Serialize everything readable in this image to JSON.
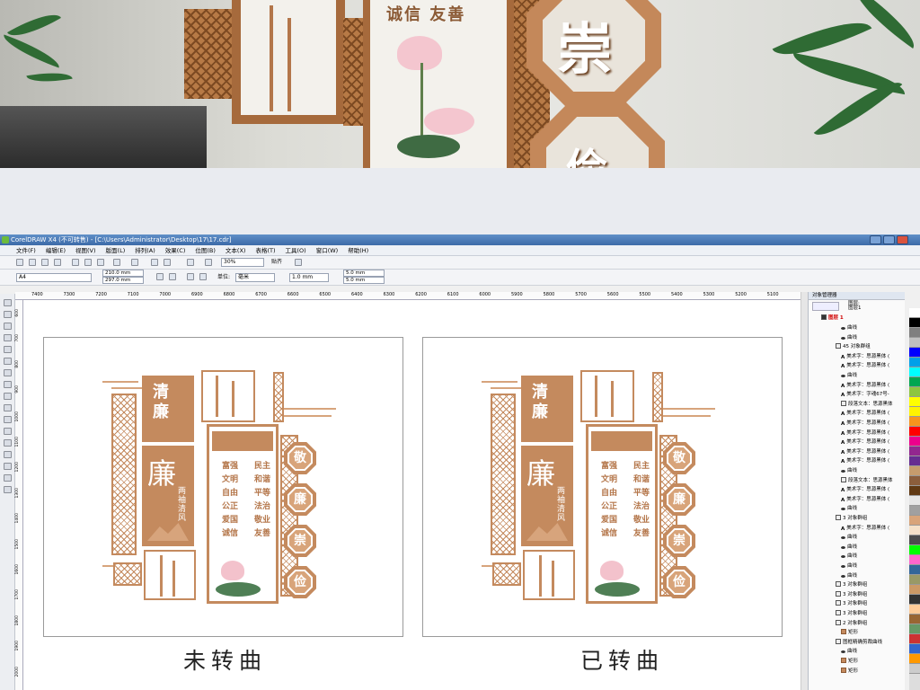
{
  "photo": {
    "panel_text_top": "诚信 友善",
    "octagon_char_1": "崇",
    "octagon_char_2": "俭"
  },
  "window": {
    "title": "CorelDRAW X4 (不可转售) - [C:\\Users\\Administrator\\Desktop\\17\\17.cdr]"
  },
  "menu": [
    "文件(F)",
    "编辑(E)",
    "视图(V)",
    "版面(L)",
    "排列(A)",
    "效果(C)",
    "位图(B)",
    "文本(X)",
    "表格(T)",
    "工具(O)",
    "窗口(W)",
    "帮助(H)"
  ],
  "toolbar": {
    "zoom": "30%",
    "snap": "贴齐",
    "page_size": "A4",
    "width": "210.0 mm",
    "height": "297.0 mm",
    "units_label": "单位:",
    "units": "毫米",
    "nudge": "1.0 mm",
    "dup_x": "5.0 mm",
    "dup_y": "5.0 mm"
  },
  "ruler_h": [
    "7400",
    "7300",
    "7200",
    "7100",
    "7000",
    "6900",
    "6800",
    "6700",
    "6600",
    "6500",
    "6400",
    "6300",
    "6200",
    "6100",
    "6000",
    "5900",
    "5800",
    "5700",
    "5600",
    "5500",
    "5400",
    "5300",
    "5200",
    "5100"
  ],
  "ruler_v": [
    "600",
    "700",
    "800",
    "900",
    "1000",
    "1100",
    "1200",
    "1300",
    "1400",
    "1500",
    "1600",
    "1700",
    "1800",
    "1900",
    "2000"
  ],
  "artwork": {
    "left_caption": "未转曲",
    "right_caption": "已转曲",
    "title_chars": [
      "清",
      "廉"
    ],
    "big_char": "廉",
    "side_text": "两袖清风",
    "values_rows": [
      [
        "富强",
        "民主"
      ],
      [
        "文明",
        "和谐"
      ],
      [
        "自由",
        "平等"
      ],
      [
        "公正",
        "法治"
      ],
      [
        "爱国",
        "敬业"
      ],
      [
        "诚信",
        "友善"
      ]
    ],
    "octagon_chars": [
      "敬",
      "廉",
      "崇",
      "俭"
    ]
  },
  "object_manager": {
    "title": "对象管理器",
    "page_label": "图层:",
    "page_sub": "图层1",
    "layer": "图层 1",
    "rows": [
      {
        "t": "curve",
        "label": "曲线",
        "indent": 1
      },
      {
        "t": "curve",
        "label": "曲线",
        "indent": 1
      },
      {
        "t": "group",
        "label": "45 对象群组",
        "indent": 0
      },
      {
        "t": "txt",
        "label": "美术字：思源黑体 (",
        "indent": 1
      },
      {
        "t": "txt",
        "label": "美术字：思源黑体 (",
        "indent": 1
      },
      {
        "t": "curve",
        "label": "曲线",
        "indent": 1
      },
      {
        "t": "txt",
        "label": "美术字：思源黑体 (",
        "indent": 1
      },
      {
        "t": "txt",
        "label": "美术字：字魂67号-",
        "indent": 1
      },
      {
        "t": "para",
        "label": "段落文本：思源黑体",
        "indent": 1
      },
      {
        "t": "txt",
        "label": "美术字：思源黑体 (",
        "indent": 1
      },
      {
        "t": "txt",
        "label": "美术字：思源黑体 (",
        "indent": 1
      },
      {
        "t": "txt",
        "label": "美术字：思源黑体 (",
        "indent": 1
      },
      {
        "t": "txt",
        "label": "美术字：思源黑体 (",
        "indent": 1
      },
      {
        "t": "txt",
        "label": "美术字：思源黑体 (",
        "indent": 1
      },
      {
        "t": "txt",
        "label": "美术字：思源黑体 (",
        "indent": 1
      },
      {
        "t": "curve",
        "label": "曲线",
        "indent": 1
      },
      {
        "t": "para",
        "label": "段落文本：思源黑体",
        "indent": 1
      },
      {
        "t": "txt",
        "label": "美术字：思源黑体 (",
        "indent": 1
      },
      {
        "t": "txt",
        "label": "美术字：思源黑体 (",
        "indent": 1
      },
      {
        "t": "curve",
        "label": "曲线",
        "indent": 1
      },
      {
        "t": "group",
        "label": "3 对象群组",
        "indent": 0
      },
      {
        "t": "txt",
        "label": "美术字：思源黑体 (",
        "indent": 1
      },
      {
        "t": "curve",
        "label": "曲线",
        "indent": 1
      },
      {
        "t": "curve",
        "label": "曲线",
        "indent": 1
      },
      {
        "t": "curve",
        "label": "曲线",
        "indent": 1
      },
      {
        "t": "curve",
        "label": "曲线",
        "indent": 1
      },
      {
        "t": "curve",
        "label": "曲线",
        "indent": 1
      },
      {
        "t": "group",
        "label": "3 对象群组",
        "indent": 0
      },
      {
        "t": "group",
        "label": "3 对象群组",
        "indent": 0
      },
      {
        "t": "group",
        "label": "3 对象群组",
        "indent": 0
      },
      {
        "t": "group",
        "label": "3 对象群组",
        "indent": 0
      },
      {
        "t": "group",
        "label": "2 对象群组",
        "indent": 0
      },
      {
        "t": "rect",
        "label": "矩形",
        "indent": 1
      },
      {
        "t": "group",
        "label": "图框精确剪裁曲线",
        "indent": 0
      },
      {
        "t": "curve",
        "label": "曲线",
        "indent": 1
      },
      {
        "t": "rect",
        "label": "矩形",
        "indent": 1
      },
      {
        "t": "rect",
        "label": "矩形",
        "indent": 1
      }
    ]
  },
  "palette": [
    "#ffffff",
    "#000000",
    "#7f7f7f",
    "#c0c0c0",
    "#0000ff",
    "#00a0e9",
    "#00ffff",
    "#00a651",
    "#8dc63f",
    "#ffff00",
    "#fff200",
    "#f7941d",
    "#ff0000",
    "#ec008c",
    "#92278f",
    "#662d91",
    "#c69c6d",
    "#8b5e3c",
    "#603913",
    "#e6e6e6",
    "#a0a0a0",
    "#d8a47a",
    "#f5e1c9",
    "#4d4d4d",
    "#00ff00",
    "#ff66cc",
    "#336699",
    "#999966",
    "#cc9966",
    "#333333",
    "#ffcc99",
    "#996633",
    "#669966",
    "#cc3333",
    "#3366cc",
    "#ff9900",
    "#cccccc"
  ]
}
